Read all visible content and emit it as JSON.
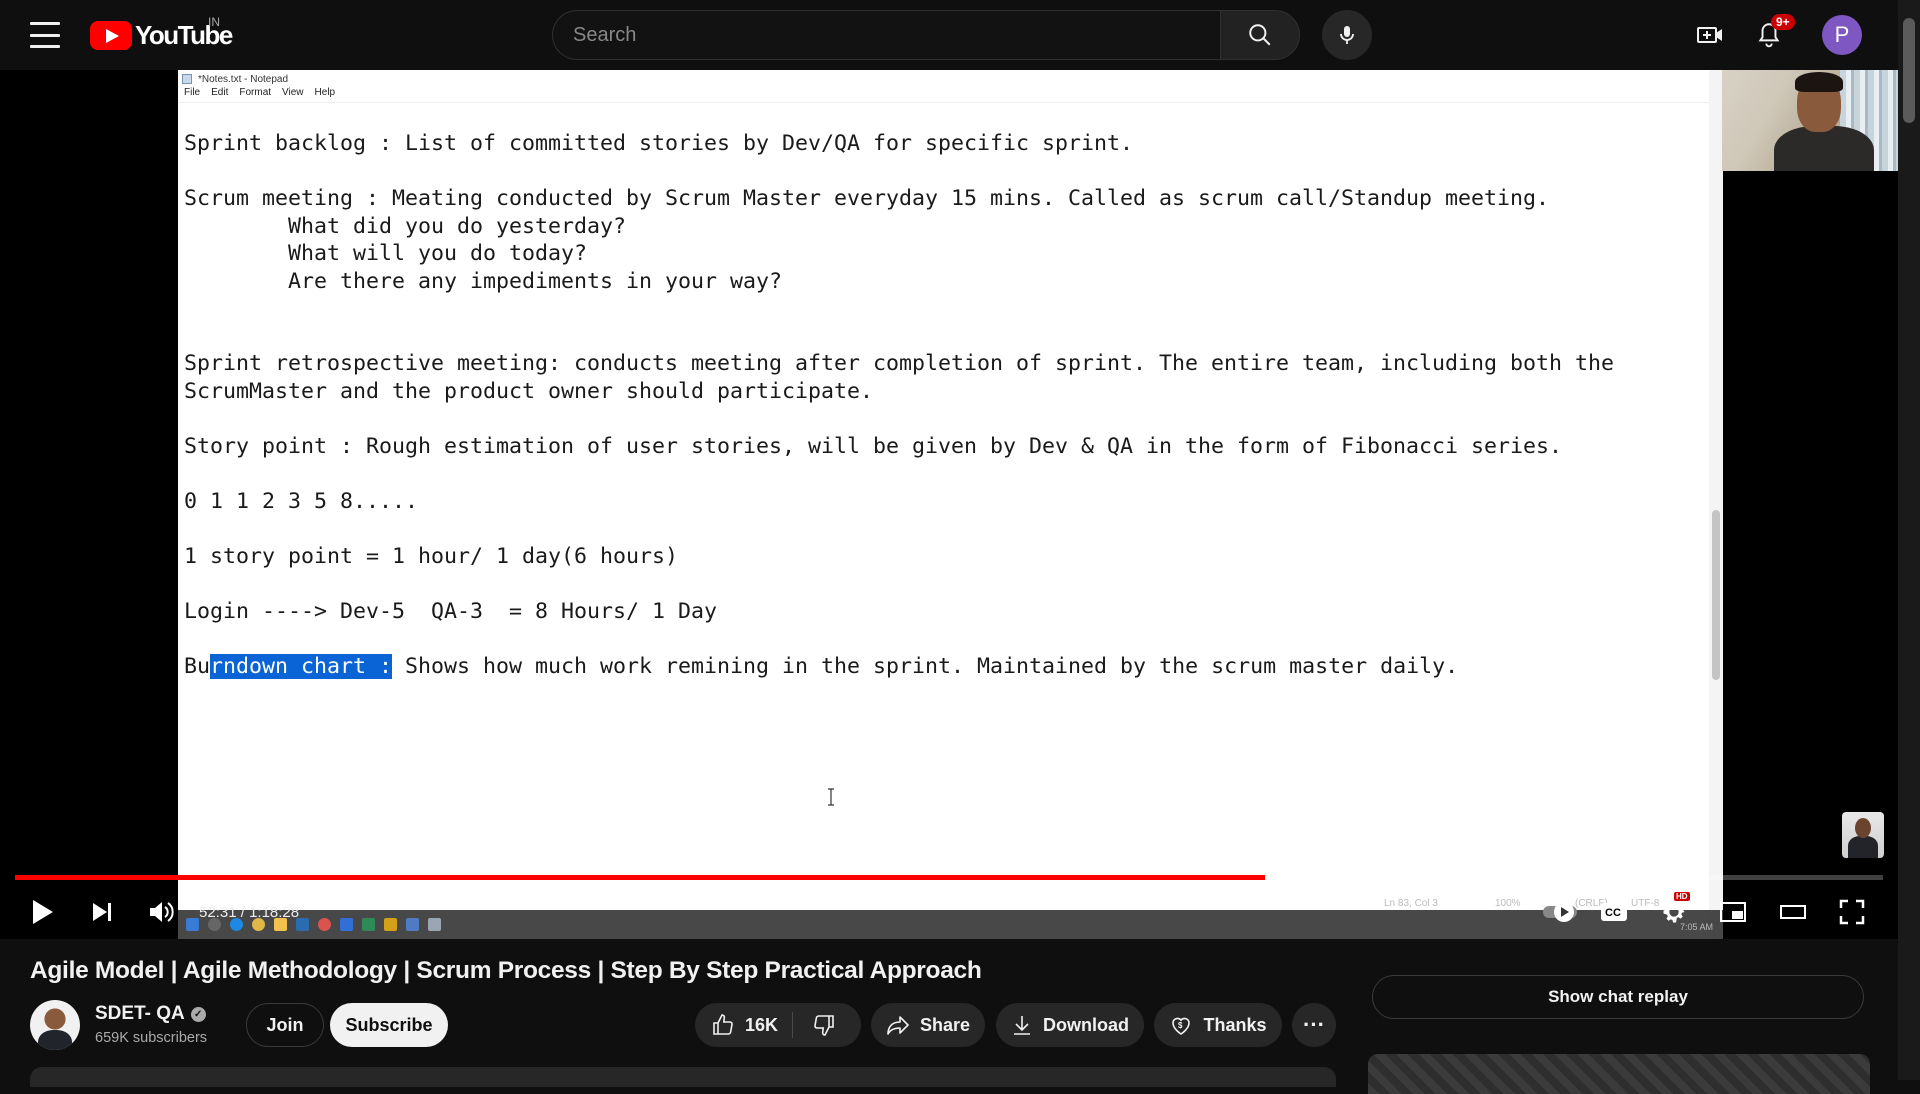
{
  "header": {
    "logo_text": "YouTube",
    "country": "IN",
    "search_placeholder": "Search",
    "notification_count": "9+",
    "avatar_letter": "P"
  },
  "video": {
    "notepad": {
      "title": "*Notes.txt - Notepad",
      "menu": [
        "File",
        "Edit",
        "Format",
        "View",
        "Help"
      ],
      "lines": {
        "l1": "Sprint backlog : List of committed stories by Dev/QA for specific sprint.",
        "l2": "",
        "l3": "Scrum meeting : Meating conducted by Scrum Master everyday 15 mins. Called as scrum call/Standup meeting.",
        "l4": "        What did you do yesterday?",
        "l5": "        What will you do today?",
        "l6": "        Are there any impediments in your way?",
        "l7": "",
        "l8": "",
        "l9": "Sprint retrospective meeting: conducts meeting after completion of sprint. The entire team, including both the",
        "l10": "ScrumMaster and the product owner should participate.",
        "l11": "",
        "l12": "Story point : Rough estimation of user stories, will be given by Dev & QA in the form of Fibonacci series.",
        "l13": "",
        "l14": "0 1 1 2 3 5 8.....",
        "l15": "",
        "l16": "1 story point = 1 hour/ 1 day(6 hours)",
        "l17": "",
        "l18": "Login ----> Dev-5  QA-3  = 8 Hours/ 1 Day",
        "l19": "",
        "l20_pre": "Bu",
        "l20_sel": "rndown chart :",
        "l20_post": " Shows how much work remining in the sprint. Maintained by the scrum master daily."
      },
      "status": {
        "position": "Ln 83, Col 3",
        "zoom": "100%",
        "line_ending": "(CRLF)",
        "encoding": "UTF-8",
        "clock": "7:05 AM"
      }
    },
    "time_current": "52:31",
    "time_separator": " / ",
    "time_total": "1:18:28",
    "progress_played_fraction": 0.669,
    "progress_buffered_fraction": 0.68,
    "hd_label": "HD"
  },
  "details": {
    "title": "Agile Model | Agile Methodology | Scrum Process | Step By Step Practical Approach",
    "channel_name": "SDET- QA",
    "subscribers": "659K subscribers",
    "join_label": "Join",
    "subscribe_label": "Subscribe",
    "like_count": "16K",
    "share_label": "Share",
    "download_label": "Download",
    "thanks_label": "Thanks",
    "more_label": "···",
    "verified_mark": "✓"
  },
  "sidebar": {
    "chat_replay_label": "Show chat replay"
  },
  "colors": {
    "accent": "#ff0000",
    "background": "#0f0f0f",
    "selection": "#0a64d6"
  }
}
